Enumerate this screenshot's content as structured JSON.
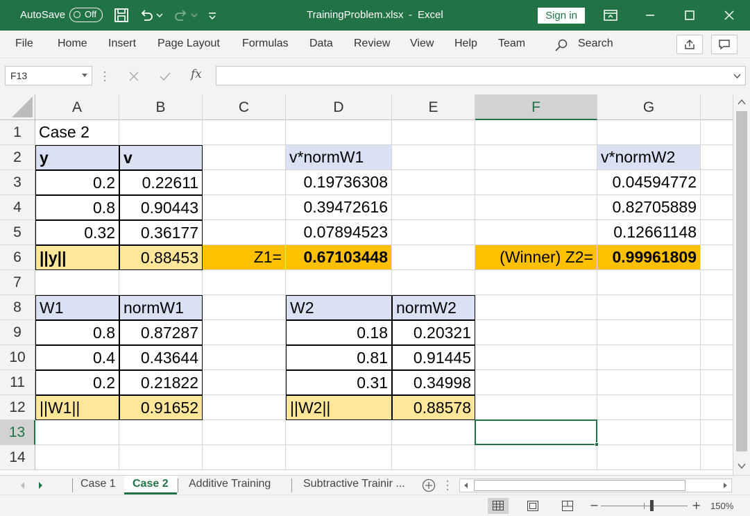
{
  "titlebar": {
    "autosave_label": "AutoSave",
    "autosave_state": "Off",
    "filename": "TrainingProblem.xlsx",
    "separator": "-",
    "app_name": "Excel",
    "signin_label": "Sign in"
  },
  "ribbon": {
    "tabs": [
      "File",
      "Home",
      "Insert",
      "Page Layout",
      "Formulas",
      "Data",
      "Review",
      "View",
      "Help",
      "Team"
    ],
    "search_label": "Search"
  },
  "formula_bar": {
    "name_box": "F13",
    "fx_label": "fx",
    "formula": ""
  },
  "grid": {
    "columns": [
      "A",
      "B",
      "C",
      "D",
      "E",
      "F",
      "G"
    ],
    "rows": [
      "1",
      "2",
      "3",
      "4",
      "5",
      "6",
      "7",
      "8",
      "9",
      "10",
      "11",
      "12",
      "13",
      "14"
    ],
    "selected_column": "F",
    "selected_row": "13",
    "cells": {
      "A1": "Case 2",
      "A2": "y",
      "B2": "v",
      "D2": "v*normW1",
      "G2": "v*normW2",
      "A3": "0.2",
      "B3": "0.22611",
      "D3": "0.19736308",
      "G3": "0.04594772",
      "A4": "0.8",
      "B4": "0.90443",
      "D4": "0.39472616",
      "G4": "0.82705889",
      "A5": "0.32",
      "B5": "0.36177",
      "D5": "0.07894523",
      "G5": "0.12661148",
      "A6": "||y||",
      "B6": "0.88453",
      "C6": "Z1=",
      "D6": "0.67103448",
      "F6": "(Winner) Z2=",
      "G6": "0.99961809",
      "A8": "W1",
      "B8": "normW1",
      "D8": "W2",
      "E8": "normW2",
      "A9": "0.8",
      "B9": "0.87287",
      "D9": "0.18",
      "E9": "0.20321",
      "A10": "0.4",
      "B10": "0.43644",
      "D10": "0.81",
      "E10": "0.91445",
      "A11": "0.2",
      "B11": "0.21822",
      "D11": "0.31",
      "E11": "0.34998",
      "A12": "||W1||",
      "B12": "0.91652",
      "D12": "||W2||",
      "E12": "0.88578"
    }
  },
  "sheet_tabs": [
    "Case 1",
    "Case 2",
    "Additive Training",
    "Subtractive Trainir ..."
  ],
  "active_sheet": "Case 2",
  "status": {
    "zoom_minus": "−",
    "zoom_plus": "+",
    "zoom_level": "150%"
  },
  "colors": {
    "excel_green": "#217346",
    "header_blue": "#d9e1f2",
    "light_yellow": "#ffe699",
    "gold": "#ffc000"
  }
}
